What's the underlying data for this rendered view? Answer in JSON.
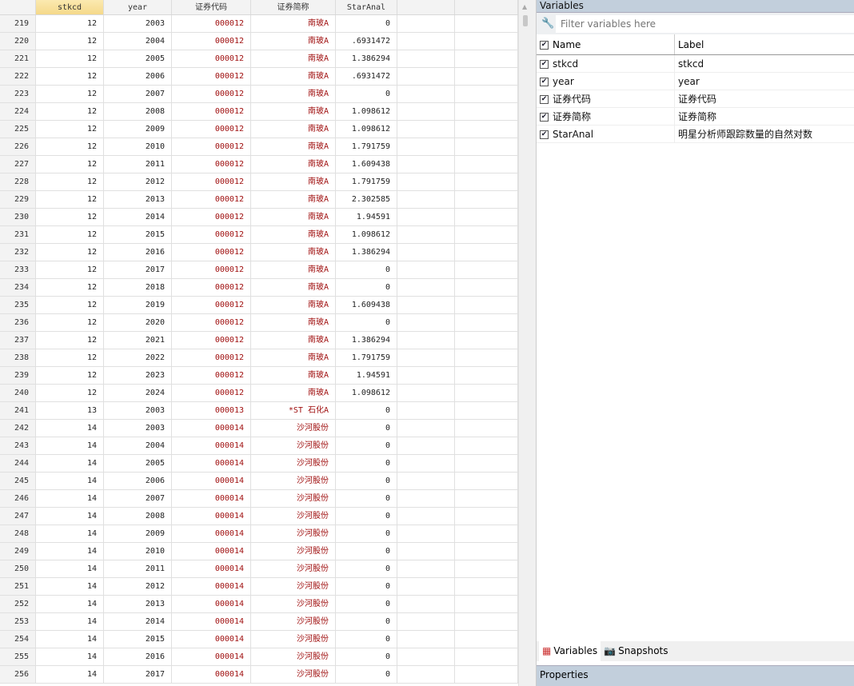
{
  "grid": {
    "headers": [
      "",
      "stkcd",
      "year",
      "证券代码",
      "证券简称",
      "StarAnal",
      "",
      ""
    ],
    "rows": [
      [
        "219",
        "12",
        "2003",
        "000012",
        "南玻A",
        "0"
      ],
      [
        "220",
        "12",
        "2004",
        "000012",
        "南玻A",
        ".6931472"
      ],
      [
        "221",
        "12",
        "2005",
        "000012",
        "南玻A",
        "1.386294"
      ],
      [
        "222",
        "12",
        "2006",
        "000012",
        "南玻A",
        ".6931472"
      ],
      [
        "223",
        "12",
        "2007",
        "000012",
        "南玻A",
        "0"
      ],
      [
        "224",
        "12",
        "2008",
        "000012",
        "南玻A",
        "1.098612"
      ],
      [
        "225",
        "12",
        "2009",
        "000012",
        "南玻A",
        "1.098612"
      ],
      [
        "226",
        "12",
        "2010",
        "000012",
        "南玻A",
        "1.791759"
      ],
      [
        "227",
        "12",
        "2011",
        "000012",
        "南玻A",
        "1.609438"
      ],
      [
        "228",
        "12",
        "2012",
        "000012",
        "南玻A",
        "1.791759"
      ],
      [
        "229",
        "12",
        "2013",
        "000012",
        "南玻A",
        "2.302585"
      ],
      [
        "230",
        "12",
        "2014",
        "000012",
        "南玻A",
        "1.94591"
      ],
      [
        "231",
        "12",
        "2015",
        "000012",
        "南玻A",
        "1.098612"
      ],
      [
        "232",
        "12",
        "2016",
        "000012",
        "南玻A",
        "1.386294"
      ],
      [
        "233",
        "12",
        "2017",
        "000012",
        "南玻A",
        "0"
      ],
      [
        "234",
        "12",
        "2018",
        "000012",
        "南玻A",
        "0"
      ],
      [
        "235",
        "12",
        "2019",
        "000012",
        "南玻A",
        "1.609438"
      ],
      [
        "236",
        "12",
        "2020",
        "000012",
        "南玻A",
        "0"
      ],
      [
        "237",
        "12",
        "2021",
        "000012",
        "南玻A",
        "1.386294"
      ],
      [
        "238",
        "12",
        "2022",
        "000012",
        "南玻A",
        "1.791759"
      ],
      [
        "239",
        "12",
        "2023",
        "000012",
        "南玻A",
        "1.94591"
      ],
      [
        "240",
        "12",
        "2024",
        "000012",
        "南玻A",
        "1.098612"
      ],
      [
        "241",
        "13",
        "2003",
        "000013",
        "*ST 石化A",
        "0"
      ],
      [
        "242",
        "14",
        "2003",
        "000014",
        "沙河股份",
        "0"
      ],
      [
        "243",
        "14",
        "2004",
        "000014",
        "沙河股份",
        "0"
      ],
      [
        "244",
        "14",
        "2005",
        "000014",
        "沙河股份",
        "0"
      ],
      [
        "245",
        "14",
        "2006",
        "000014",
        "沙河股份",
        "0"
      ],
      [
        "246",
        "14",
        "2007",
        "000014",
        "沙河股份",
        "0"
      ],
      [
        "247",
        "14",
        "2008",
        "000014",
        "沙河股份",
        "0"
      ],
      [
        "248",
        "14",
        "2009",
        "000014",
        "沙河股份",
        "0"
      ],
      [
        "249",
        "14",
        "2010",
        "000014",
        "沙河股份",
        "0"
      ],
      [
        "250",
        "14",
        "2011",
        "000014",
        "沙河股份",
        "0"
      ],
      [
        "251",
        "14",
        "2012",
        "000014",
        "沙河股份",
        "0"
      ],
      [
        "252",
        "14",
        "2013",
        "000014",
        "沙河股份",
        "0"
      ],
      [
        "253",
        "14",
        "2014",
        "000014",
        "沙河股份",
        "0"
      ],
      [
        "254",
        "14",
        "2015",
        "000014",
        "沙河股份",
        "0"
      ],
      [
        "255",
        "14",
        "2016",
        "000014",
        "沙河股份",
        "0"
      ],
      [
        "256",
        "14",
        "2017",
        "000014",
        "沙河股份",
        "0"
      ]
    ]
  },
  "variables": {
    "title": "Variables",
    "filter_placeholder": "Filter variables here",
    "col_name": "Name",
    "col_label": "Label",
    "items": [
      {
        "name": "stkcd",
        "label": "stkcd"
      },
      {
        "name": "year",
        "label": "year"
      },
      {
        "name": "证券代码",
        "label": "证券代码"
      },
      {
        "name": "证券简称",
        "label": "证券简称"
      },
      {
        "name": "StarAnal",
        "label": "明星分析师跟踪数量的自然对数"
      }
    ],
    "tabs": [
      "Variables",
      "Snapshots"
    ]
  },
  "properties": {
    "title": "Properties"
  },
  "colors": {
    "string": "#a01010",
    "panel_header": "#c2cfdc",
    "selected_header": "#f5d98a"
  }
}
